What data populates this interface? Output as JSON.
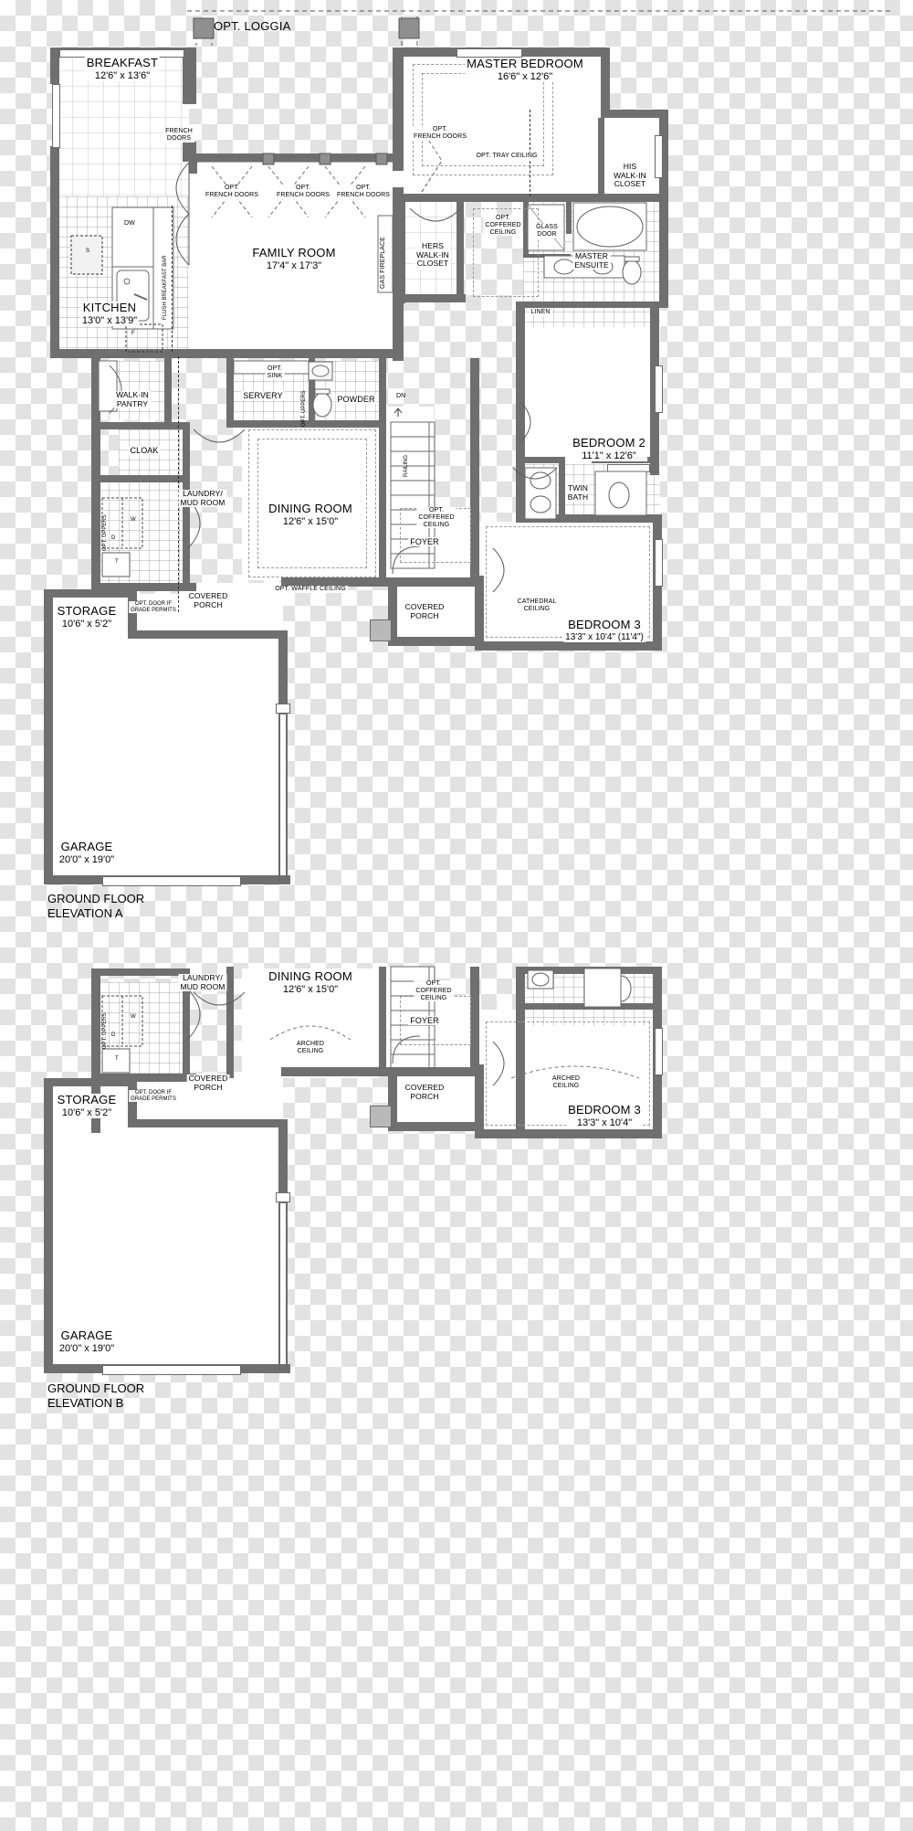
{
  "document": {
    "type": "architectural-floor-plan",
    "sheets": [
      {
        "id": "A",
        "caption_line1": "GROUND FLOOR",
        "caption_line2": "ELEVATION A"
      },
      {
        "id": "B",
        "caption_line1": "GROUND FLOOR",
        "caption_line2": "ELEVATION B"
      }
    ]
  },
  "elevation_a": {
    "rooms": [
      {
        "name": "BREAKFAST",
        "dim": "12'6\" x 13'6\""
      },
      {
        "name": "MASTER BEDROOM",
        "dim": "16'6\" x 12'6\""
      },
      {
        "name": "FAMILY ROOM",
        "dim": "17'4\" x 17'3\""
      },
      {
        "name": "KITCHEN",
        "dim": "13'0\" x 13'9\""
      },
      {
        "name": "DINING ROOM",
        "dim": "12'6\" x 15'0\""
      },
      {
        "name": "STORAGE",
        "dim": "10'6\" x 5'2\""
      },
      {
        "name": "GARAGE",
        "dim": "20'0\" x 19'0\""
      },
      {
        "name": "BEDROOM 2",
        "dim": "11'1\" x 12'6\""
      },
      {
        "name": "BEDROOM 3",
        "dim": "13'3\" x 10'4\" (11'4\")"
      }
    ],
    "small_rooms": [
      {
        "name": "HIS\nWALK-IN\nCLOSET"
      },
      {
        "name": "HERS\nWALK-IN\nCLOSET"
      },
      {
        "name": "MASTER\nENSUITE"
      },
      {
        "name": "TWIN\nBATH"
      },
      {
        "name": "WALK-IN\nPANTRY"
      },
      {
        "name": "LAUNDRY/\nMUD ROOM"
      },
      {
        "name": "COVERED\nPORCH"
      },
      {
        "name": "SERVERY"
      },
      {
        "name": "POWDER"
      },
      {
        "name": "CLOAK"
      },
      {
        "name": "FOYER"
      },
      {
        "name": "LINEN"
      }
    ],
    "labels": {
      "opt_loggia": "OPT. LOGGIA",
      "french_doors": "FRENCH\nDOORS",
      "opt_french_doors": "OPT.\nFRENCH DOORS",
      "opt_tray_ceiling": "OPT. TRAY CEILING",
      "opt_coffered_ceiling": "OPT.\nCOFFERED\nCEILING",
      "opt_waffle_ceiling": "OPT. WAFFLE CEILING",
      "cathedral_ceiling": "CATHEDRAL\nCEILING",
      "gas_fireplace": "GAS FIREPLACE",
      "flush_breakfast_bar": "FLUSH BREAKFAST BAR",
      "glass_door": "GLASS\nDOOR",
      "opt_sink": "OPT.\nSINK",
      "opt_uppers": "OPT. UPPERS",
      "opt_door_if_grade_permits": "OPT. DOOR IF\nGRADE PERMITS",
      "railing": "RAILING",
      "dn": "DN",
      "dw": "DW",
      "washer": "W",
      "dryer": "D",
      "stove": "S",
      "fridge": "F",
      "tub": "T"
    },
    "caption": {
      "line1": "GROUND FLOOR",
      "line2": "ELEVATION A"
    }
  },
  "elevation_b": {
    "rooms": [
      {
        "name": "DINING ROOM",
        "dim": "12'6\" x 15'0\""
      },
      {
        "name": "STORAGE",
        "dim": "10'6\" x 5'2\""
      },
      {
        "name": "GARAGE",
        "dim": "20'0\" x 19'0\""
      },
      {
        "name": "BEDROOM 3",
        "dim": "13'3\" x 10'4\""
      }
    ],
    "small_rooms": [
      {
        "name": "LAUNDRY/\nMUD ROOM"
      },
      {
        "name": "COVERED\nPORCH"
      },
      {
        "name": "FOYER"
      }
    ],
    "labels": {
      "opt_coffered_ceiling": "OPT.\nCOFFERED\nCEILING",
      "arched_ceiling": "ARCHED\nCEILING",
      "opt_door_if_grade_permits": "OPT. DOOR IF\nGRADE PERMITS",
      "opt_uppers": "OPT. UPPERS",
      "washer": "W",
      "dryer": "D",
      "tub": "T"
    },
    "caption": {
      "line1": "GROUND FLOOR",
      "line2": "ELEVATION B"
    }
  },
  "colors": {
    "wall": "#706f6f",
    "thin_wall": "#6a6a6a",
    "text": "#000000",
    "grid": "rgba(0,0,0,0.10)",
    "paper": "#ffffff"
  }
}
